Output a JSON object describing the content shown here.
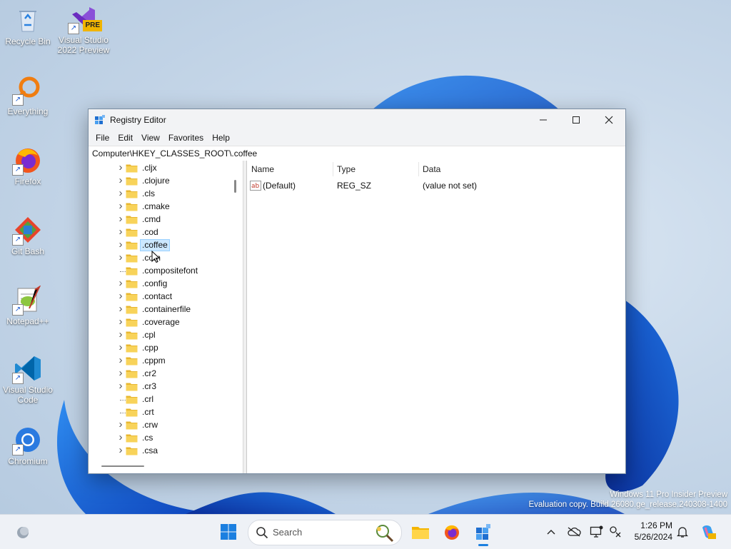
{
  "desktop": {
    "icons": [
      {
        "label": "Recycle Bin"
      },
      {
        "label": "Visual Studio 2022 Preview",
        "badge": "PRE"
      },
      {
        "label": "Everything"
      },
      {
        "label": "Firefox"
      },
      {
        "label": "Git Bash"
      },
      {
        "label": "Notepad++"
      },
      {
        "label": "Visual Studio Code"
      },
      {
        "label": "Chromium"
      }
    ]
  },
  "window": {
    "title": "Registry Editor",
    "menu": [
      "File",
      "Edit",
      "View",
      "Favorites",
      "Help"
    ],
    "address": "Computer\\HKEY_CLASSES_ROOT\\.coffee",
    "tree": [
      {
        "label": ".cljx",
        "expandable": true
      },
      {
        "label": ".clojure",
        "expandable": true
      },
      {
        "label": ".cls",
        "expandable": true
      },
      {
        "label": ".cmake",
        "expandable": true
      },
      {
        "label": ".cmd",
        "expandable": true
      },
      {
        "label": ".cod",
        "expandable": true
      },
      {
        "label": ".coffee",
        "expandable": true,
        "selected": true
      },
      {
        "label": ".com",
        "expandable": true
      },
      {
        "label": ".compositefont",
        "expandable": false
      },
      {
        "label": ".config",
        "expandable": true
      },
      {
        "label": ".contact",
        "expandable": true
      },
      {
        "label": ".containerfile",
        "expandable": true
      },
      {
        "label": ".coverage",
        "expandable": true
      },
      {
        "label": ".cpl",
        "expandable": true
      },
      {
        "label": ".cpp",
        "expandable": true
      },
      {
        "label": ".cppm",
        "expandable": true
      },
      {
        "label": ".cr2",
        "expandable": true
      },
      {
        "label": ".cr3",
        "expandable": true
      },
      {
        "label": ".crl",
        "expandable": false
      },
      {
        "label": ".crt",
        "expandable": false
      },
      {
        "label": ".crw",
        "expandable": true
      },
      {
        "label": ".cs",
        "expandable": true
      },
      {
        "label": ".csa",
        "expandable": true
      }
    ],
    "columns": {
      "name": "Name",
      "type": "Type",
      "data": "Data"
    },
    "values": [
      {
        "name": "(Default)",
        "type": "REG_SZ",
        "data": "(value not set)"
      }
    ]
  },
  "taskbar": {
    "search_placeholder": "Search",
    "time": "1:26 PM",
    "date": "5/26/2024"
  },
  "watermark": {
    "line1": "Windows 11 Pro Insider Preview",
    "line2": "Evaluation copy. Build 26080.ge_release.240308-1400"
  }
}
